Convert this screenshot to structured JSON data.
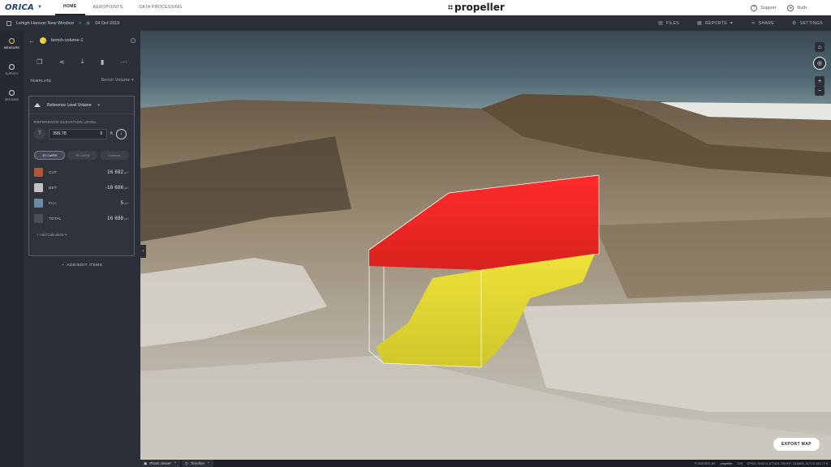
{
  "header": {
    "logo_text": "ORICA",
    "tabs": [
      {
        "label": "HOME",
        "active": true
      },
      {
        "label": "AEROPOINTS",
        "active": false
      },
      {
        "label": "DATA PROCESSING",
        "active": false
      }
    ],
    "brand": "propeller",
    "support_label": "Support",
    "user_label": "Ruth"
  },
  "subheader": {
    "site": "Lehigh Hanson New Windsor",
    "date": "04 Oct 2019",
    "actions": [
      {
        "label": "FILES",
        "icon": "files-icon"
      },
      {
        "label": "REPORTS",
        "icon": "reports-icon"
      },
      {
        "label": "SHARE",
        "icon": "share-icon"
      },
      {
        "label": "SETTINGS",
        "icon": "settings-icon"
      }
    ]
  },
  "rail": {
    "items": [
      {
        "label": "MEASURE",
        "active": true
      },
      {
        "label": "SURVEY",
        "active": false
      },
      {
        "label": "DESIGNS",
        "active": false
      }
    ]
  },
  "panel": {
    "measurement_name": "bench-volume-1",
    "template_label": "TEMPLATE",
    "template_value": "Bench Volume",
    "card_title": "Reference Level Volume",
    "elevation_label": "REFERENCE ELEVATION LEVEL",
    "elevation_value": "399.78",
    "elevation_unit": "ft",
    "modes": [
      "3D Cut/Fill",
      "2D Cut/Fill",
      "Contours"
    ],
    "rows": [
      {
        "name": "CUT",
        "value": "16 692",
        "unit": "yd³",
        "color": "#b4553a"
      },
      {
        "name": "NET",
        "value": "-16 686",
        "unit": "yd³",
        "color": "#c2c2c2"
      },
      {
        "name": "FILL",
        "value": "5",
        "unit": "yd³",
        "color": "#6c8aa0"
      },
      {
        "name": "TOTAL",
        "value": "16 698",
        "unit": "yd³",
        "color": "#4a4e55"
      }
    ],
    "add_calculator": "+ Add Calculator ▾",
    "add_items": "ADD/EDIT ITEMS"
  },
  "viewport": {
    "export_label": "EXPORT MAP",
    "cut_color": "#f2232a",
    "fill_color": "#e2d82c"
  },
  "footer": {
    "photo_viewer": "Photo viewer",
    "timeline": "Timeline",
    "powered_by": "POWERED BY",
    "brand": "propeller",
    "scale": "10ft",
    "coords": "EPSG: 6348  N: 677424.789 ft   E: 1810691.3174 ft   441.77 ft"
  }
}
